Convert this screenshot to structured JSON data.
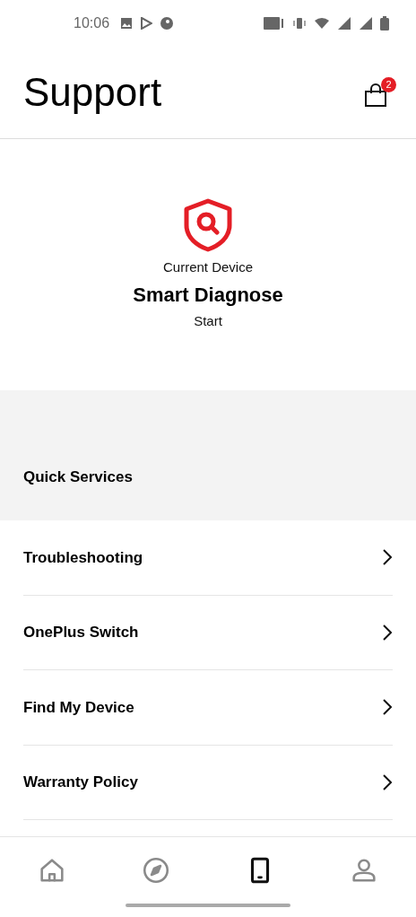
{
  "status_bar": {
    "time": "10:06"
  },
  "header": {
    "title": "Support",
    "cart_badge": "2"
  },
  "diagnose": {
    "caption": "Current Device",
    "title": "Smart Diagnose",
    "action": "Start"
  },
  "quick_services": {
    "heading": "Quick Services",
    "items": [
      {
        "label": "Troubleshooting"
      },
      {
        "label": "OnePlus Switch"
      },
      {
        "label": "Find My Device"
      },
      {
        "label": "Warranty Policy"
      }
    ]
  },
  "bottom_nav": [
    {
      "kind": "home",
      "selected": false
    },
    {
      "kind": "explore",
      "selected": false
    },
    {
      "kind": "device",
      "selected": true
    },
    {
      "kind": "account",
      "selected": false
    }
  ]
}
